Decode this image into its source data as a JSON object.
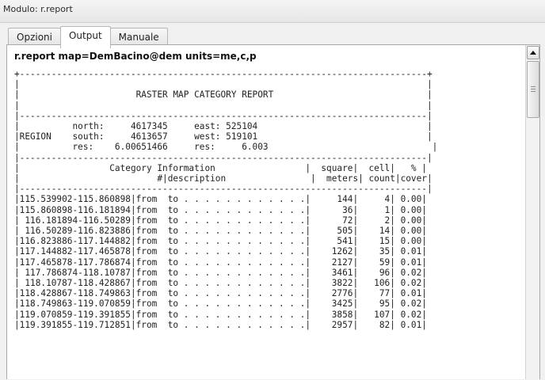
{
  "window": {
    "title": "Modulo: r.report"
  },
  "tabs": [
    {
      "label": "Opzioni"
    },
    {
      "label": "Output"
    },
    {
      "label": "Manuale"
    }
  ],
  "output": {
    "command": "r.report map=DemBacino@dem units=me,c,p",
    "report_lines": [
      "+-----------------------------------------------------------------------------+",
      "|                                                                             |",
      "|                      RASTER MAP CATEGORY REPORT                             |",
      "|                                                                             |",
      "|-----------------------------------------------------------------------------|",
      "|          north:     4617345     east: 525104                                |",
      "|REGION    south:     4613657     west: 519101                                |",
      "|          res:    6.00651466     res:     6.003                               |",
      "|-----------------------------------------------------------------------------|",
      "|                 Category Information                 |  square|  cell|   % |",
      "|                          #|description                |  meters| count|cover|",
      "|-----------------------------------------------------------------------------|",
      "|115.539902-115.860898|from  to . . . . . . . . . . . .|     144|     4| 0.00|",
      "|115.860898-116.181894|from  to . . . . . . . . . . . .|      36|     1| 0.00|",
      "| 116.181894-116.50289|from  to . . . . . . . . . . . .|      72|     2| 0.00|",
      "| 116.50289-116.823886|from  to . . . . . . . . . . . .|     505|    14| 0.00|",
      "|116.823886-117.144882|from  to . . . . . . . . . . . .|     541|    15| 0.00|",
      "|117.144882-117.465878|from  to . . . . . . . . . . . .|    1262|    35| 0.01|",
      "|117.465878-117.786874|from  to . . . . . . . . . . . .|    2127|    59| 0.01|",
      "| 117.786874-118.10787|from  to . . . . . . . . . . . .|    3461|    96| 0.02|",
      "| 118.10787-118.428867|from  to . . . . . . . . . . . .|    3822|   106| 0.02|",
      "|118.428867-118.749863|from  to . . . . . . . . . . . .|    2776|    77| 0.01|",
      "|118.749863-119.070859|from  to . . . . . . . . . . . .|    3425|    95| 0.02|",
      "|119.070859-119.391855|from  to . . . . . . . . . . . .|    3858|   107| 0.02|",
      "|119.391855-119.712851|from  to . . . . . . . . . . . .|    2957|    82| 0.01|"
    ]
  }
}
